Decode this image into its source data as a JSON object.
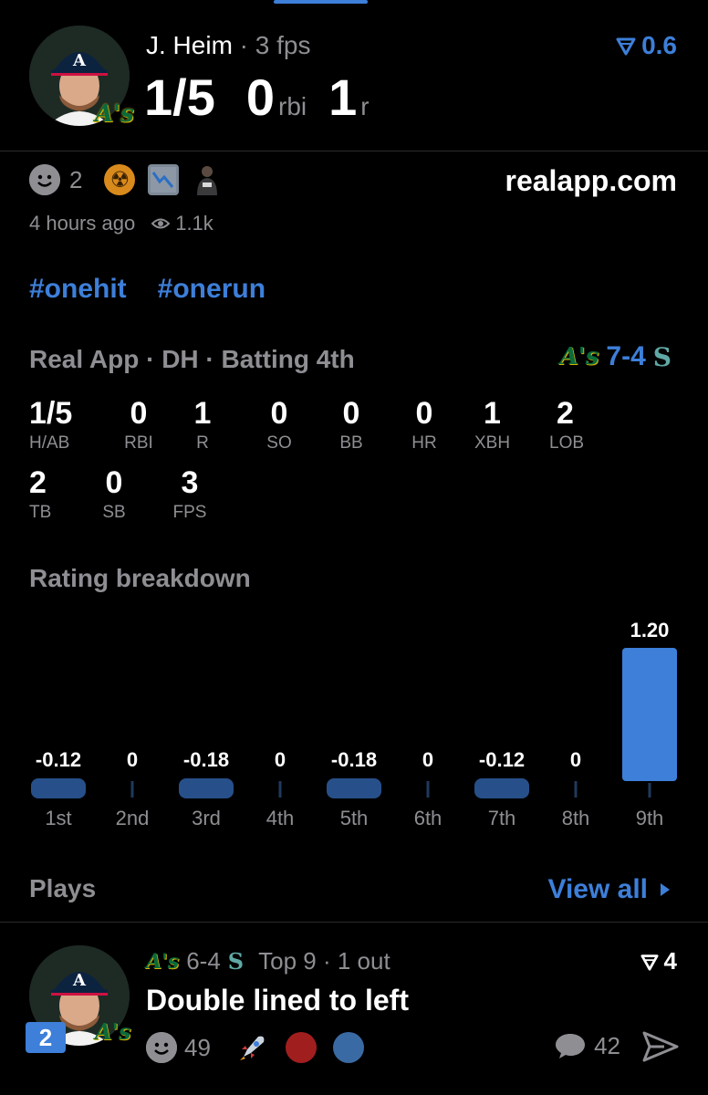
{
  "header": {
    "player_name": "J. Heim",
    "separator": " · ",
    "fps_label": "3 fps",
    "rating": "0.6",
    "stat_hits": "1/5",
    "stat_rbi": "0",
    "rbi_unit": "rbi",
    "stat_runs": "1",
    "runs_unit": "r",
    "team_badge": "A's"
  },
  "post": {
    "reaction_count": "2",
    "site": "realapp.com",
    "time": "4 hours ago",
    "views": "1.1k",
    "tags": [
      "#onehit",
      "#onerun"
    ]
  },
  "game": {
    "info": "Real App · DH · Batting 4th",
    "team_a_logo": "A's",
    "score": "7-4",
    "team_b_logo": "S"
  },
  "stats": [
    {
      "value": "1/5",
      "label": "H/AB"
    },
    {
      "value": "0",
      "label": "RBI"
    },
    {
      "value": "1",
      "label": "R"
    },
    {
      "value": "0",
      "label": "SO"
    },
    {
      "value": "0",
      "label": "BB"
    },
    {
      "value": "0",
      "label": "HR"
    },
    {
      "value": "1",
      "label": "XBH"
    },
    {
      "value": "2",
      "label": "LOB"
    },
    {
      "value": "2",
      "label": "TB"
    },
    {
      "value": "0",
      "label": "SB"
    },
    {
      "value": "3",
      "label": "FPS"
    }
  ],
  "rating_breakdown": {
    "title": "Rating breakdown"
  },
  "chart_data": {
    "type": "bar",
    "title": "Rating breakdown",
    "categories": [
      "1st",
      "2nd",
      "3rd",
      "4th",
      "5th",
      "6th",
      "7th",
      "8th",
      "9th"
    ],
    "values": [
      -0.12,
      0,
      -0.18,
      0,
      -0.18,
      0,
      -0.12,
      0,
      1.2
    ],
    "value_labels": [
      "-0.12",
      "0",
      "-0.18",
      "0",
      "-0.18",
      "0",
      "-0.12",
      "0",
      "1.20"
    ],
    "bar_color": "#3d7fd9"
  },
  "plays": {
    "title": "Plays",
    "view_all": "View all",
    "item": {
      "badge": "2",
      "team_badge": "A's",
      "score": "6-4",
      "team_b_logo": "S",
      "inning": "Top 9 · 1 out",
      "rating": "4",
      "description": "Double lined to left",
      "reaction_count": "49",
      "comment_count": "42",
      "dot_colors": [
        "#a11e1e",
        "#3a6aa3"
      ]
    }
  },
  "colors": {
    "accent": "#3d7fd9",
    "muted": "#8e8e93",
    "background": "#000000"
  }
}
